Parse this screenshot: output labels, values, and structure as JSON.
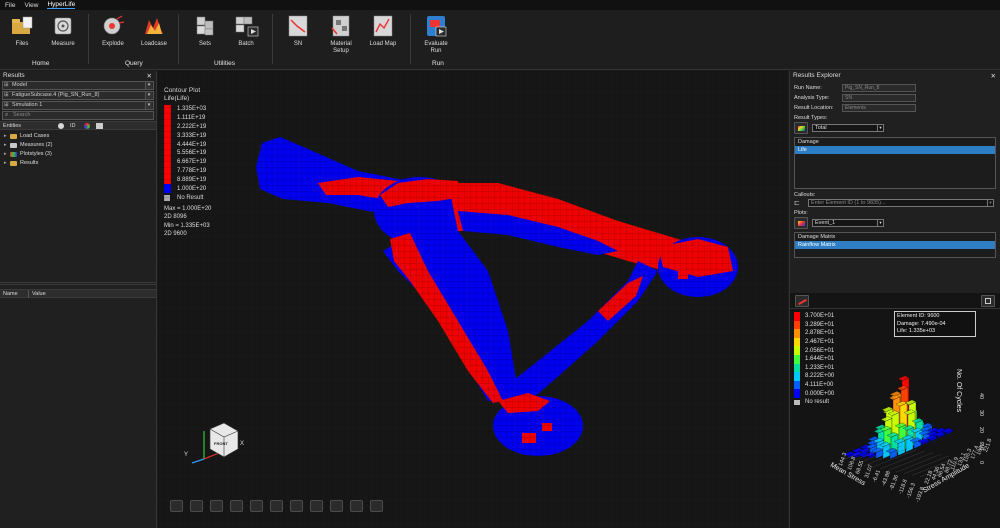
{
  "menu": [
    {
      "label": "File",
      "active": false
    },
    {
      "label": "View",
      "active": false
    },
    {
      "label": "HyperLife",
      "active": true
    }
  ],
  "ribbon": {
    "tools": [
      {
        "label": "Files",
        "icon": "folder-files-icon"
      },
      {
        "label": "Measure",
        "icon": "measure-icon"
      },
      {
        "label": "Explode",
        "icon": "explode-icon"
      },
      {
        "label": "Loadcase",
        "icon": "loadcase-icon"
      },
      {
        "label": "Sets",
        "icon": "sets-icon"
      },
      {
        "label": "Batch",
        "icon": "batch-icon"
      },
      {
        "label": "SN",
        "icon": "sn-curve-icon"
      },
      {
        "label": "Material\nSetup",
        "icon": "material-setup-icon"
      },
      {
        "label": "Load Map",
        "icon": "load-map-icon"
      },
      {
        "label": "Evaluate\nRun",
        "icon": "evaluate-run-icon"
      }
    ],
    "groups": [
      "Home",
      "Query",
      "Utilities",
      "Run"
    ]
  },
  "left_panel": {
    "title": "Results",
    "model_select": "Model",
    "subcase_select": "FatigueSubcase.4 (Pig_SN_Run_8)",
    "simulation_select": "Simulation 1",
    "search_placeholder": "Search",
    "entities_header": "Entities",
    "id_header": "ID",
    "tree": [
      "Load Cases",
      "Measures (2)",
      "Plotstyles (3)",
      "Results"
    ],
    "name_header": "Name",
    "value_header": "Value"
  },
  "legend": {
    "title1": "Contour Plot",
    "title2": "Life(Life)",
    "colors": [
      "#ff0000",
      "#ff0000",
      "#ff0000",
      "#ff0000",
      "#ff0000",
      "#ff0000",
      "#ff0000",
      "#ff0000",
      "#ff0000",
      "#0000ff"
    ],
    "values": [
      "1.335E+03",
      "1.111E+19",
      "2.222E+19",
      "3.333E+19",
      "4.444E+19",
      "5.556E+19",
      "6.667E+19",
      "7.778E+19",
      "8.889E+19",
      "1.000E+20"
    ],
    "no_result": "No Result",
    "max": "Max = 1.000E+20",
    "max_elem": "2D 8096",
    "min": "Min = 1.335E+03",
    "min_elem": "2D 9600"
  },
  "triad": {
    "x": "X",
    "y": "Y",
    "cube_label": "FRONT"
  },
  "right_panel": {
    "title": "Results Explorer",
    "run_name_label": "Run Name:",
    "run_name_value": "Pig_SN_Run_8",
    "analysis_type_label": "Analysis Type:",
    "analysis_type_value": "SN",
    "result_location_label": "Result Location:",
    "result_location_value": "Elements",
    "result_types_label": "Result Types:",
    "result_types_select": "Total",
    "result_list": [
      {
        "label": "Damage",
        "selected": false
      },
      {
        "label": "Life",
        "selected": true
      }
    ],
    "callouts_label": "Callouts:",
    "callouts_placeholder": "Enter Element ID (1 to 9835)...",
    "plots_label": "Plots:",
    "plots_select": "Event_1",
    "plots_list": [
      {
        "label": "Damage Matrix",
        "selected": false
      },
      {
        "label": "Rainflow Matrix",
        "selected": true
      }
    ]
  },
  "rainflow": {
    "legend_values": [
      "3.700E+01",
      "3.289E+01",
      "2.878E+01",
      "2.467E+01",
      "2.056E+01",
      "1.644E+01",
      "1.233E+01",
      "8.222E+00",
      "4.111E+00",
      "0.000E+00"
    ],
    "legend_colors": [
      "#ff0000",
      "#ff4000",
      "#ff9000",
      "#ffd800",
      "#c8ff00",
      "#40ff40",
      "#00e0a0",
      "#00c8ff",
      "#0060ff",
      "#0000ff"
    ],
    "no_result": "No result",
    "tooltip_id": "Element ID: 9600",
    "tooltip_damage": "Damage: 7.490e-04",
    "tooltip_life": "Life: 1.335e+03",
    "mean_ticks": [
      "144.3",
      "106.8",
      "68.55",
      "31.07",
      "-6.41",
      "-43.88",
      "-81.36",
      "-118.8",
      "-156.3",
      "-193.8"
    ],
    "amp_ticks": [
      "22.18",
      "44.36",
      "66.54",
      "88.72",
      "110.9",
      "133.1",
      "155.3",
      "177.4",
      "199.6",
      "221.8"
    ],
    "z_ticks": [
      "0",
      "10",
      "20",
      "30",
      "40"
    ],
    "xlabel": "Mean Stress",
    "ylabel": "Stress Amplitude",
    "zlabel": "No. Of Cycles"
  }
}
